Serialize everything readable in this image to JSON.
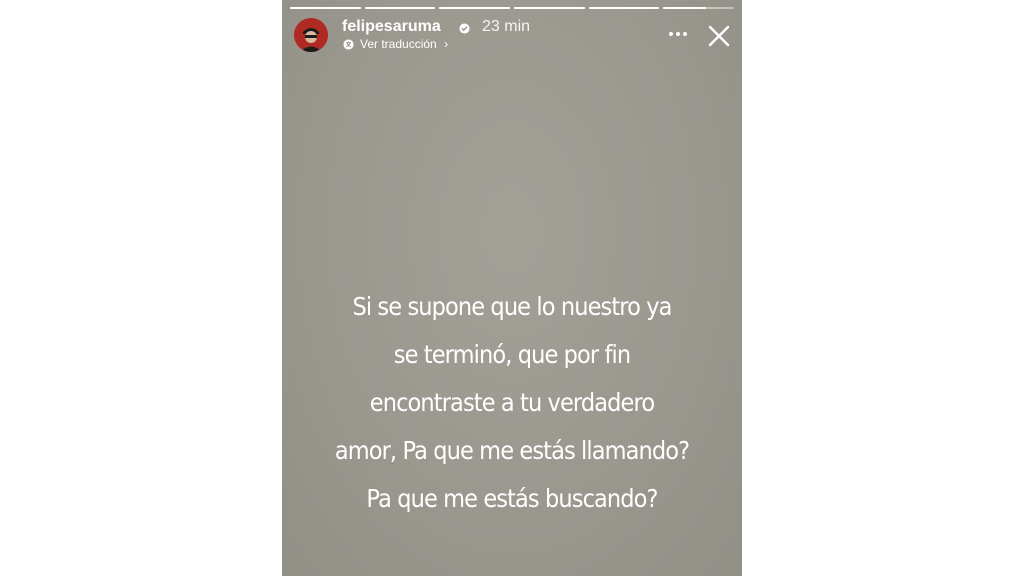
{
  "story": {
    "username": "felipesaruma",
    "time_ago": "23 min",
    "translate_label": "Ver traducción",
    "progress": [
      1,
      1,
      1,
      1,
      1,
      0.6
    ],
    "message_lines": [
      "Si se supone que lo nuestro ya",
      "se terminó, que por fin",
      "encontraste a tu verdadero",
      "amor, Pa que me estás llamando?",
      "Pa que me estás buscando?"
    ],
    "icons": {
      "verified": "verified-badge-icon",
      "translate": "translate-icon",
      "more": "more-options-icon",
      "close": "close-icon"
    },
    "colors": {
      "background": "#9a988f",
      "text": "#ffffff",
      "avatar": "#b02a24"
    }
  }
}
